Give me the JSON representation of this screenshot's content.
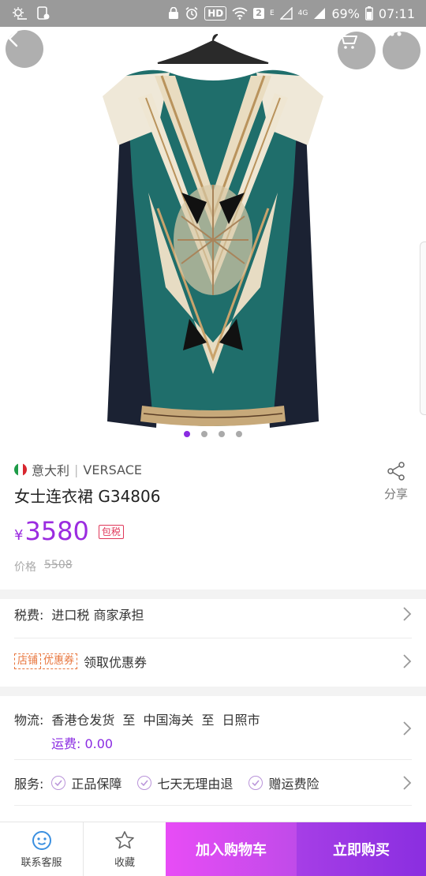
{
  "status_bar": {
    "network_badge": "HD",
    "sim_badge": "2",
    "net_small": "E",
    "net_4g": "4G",
    "battery": "69%",
    "time": "07:11"
  },
  "hero": {
    "image_count": 4,
    "active_index": 0
  },
  "product": {
    "origin": "意大利",
    "brand": "VERSACE",
    "brand_separator": "|",
    "title": "女士连衣裙 G34806",
    "share_label": "分享",
    "currency": "¥",
    "price": "3580",
    "tax_badge": "包税",
    "original_label": "价格",
    "original_price": "5508"
  },
  "tax_row": {
    "label": "税费:",
    "value": "进口税 商家承担"
  },
  "coupon_row": {
    "tag_store": "店铺",
    "tag_coupon": "优惠券",
    "text": "领取优惠券"
  },
  "logistics": {
    "label": "物流:",
    "from": "香港仓发货",
    "to_word1": "至",
    "customs": "中国海关",
    "to_word2": "至",
    "city": "日照市",
    "fee": "运费: 0.00"
  },
  "service": {
    "label": "服务:",
    "items": [
      "正品保障",
      "七天无理由退",
      "赠运费险"
    ]
  },
  "bottom_bar": {
    "support": "联系客服",
    "favorite": "收藏",
    "add_to_cart": "加入购物车",
    "buy_now": "立即购买"
  },
  "colors": {
    "accent": "#8a2be2",
    "price": "#9b2ce0",
    "add_cart_bg": "#e84cf6",
    "buy_bg": "#8a2ee0"
  },
  "icons": [
    "back-arrow-icon",
    "cart-icon",
    "more-icon",
    "share-icon",
    "chevron-right-icon",
    "check-icon",
    "customer-service-icon",
    "star-icon",
    "italy-flag-icon"
  ]
}
